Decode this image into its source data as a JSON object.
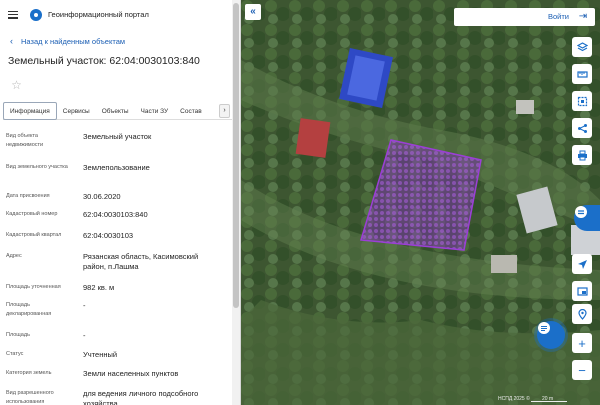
{
  "header": {
    "menu_icon": "hamburger-icon",
    "logo_icon": "portal-logo-icon",
    "title": "Геоинформационный портал"
  },
  "back_link": {
    "label": "Назад к найденным объектам",
    "icon": "chevron-left-icon"
  },
  "object": {
    "title": "Земельный участок: 62:04:0030103:840",
    "favorite_icon": "star-icon"
  },
  "tabs": [
    {
      "label": "Информация",
      "active": true
    },
    {
      "label": "Сервисы",
      "active": false
    },
    {
      "label": "Объекты",
      "active": false
    },
    {
      "label": "Части ЗУ",
      "active": false
    },
    {
      "label": "Состав",
      "active": false
    }
  ],
  "tab_scroll_icon": "chevron-right-icon",
  "attributes": [
    {
      "label": "Вид объекта недвижимости",
      "value": "Земельный участок"
    },
    {
      "label": "Вид земельного участка",
      "value": "Землепользование"
    },
    {
      "label": "Дата присвоения",
      "value": "30.06.2020"
    },
    {
      "label": "Кадастровый номер",
      "value": "62:04:0030103:840"
    },
    {
      "label": "Кадастровый квартал",
      "value": "62:04:0030103"
    },
    {
      "label": "Адрес",
      "value": "Рязанская область, Касимовский район, п.Лашма"
    },
    {
      "label": "Площадь уточненная",
      "value": "982 кв. м"
    },
    {
      "label": "Площадь декларированная",
      "value": "-"
    },
    {
      "label": "Площадь",
      "value": "-"
    },
    {
      "label": "Статус",
      "value": "Учтенный"
    },
    {
      "label": "Категория земель",
      "value": "Земли населенных пунктов"
    },
    {
      "label": "Вид разрешенного использования",
      "value": "для ведения личного подсобного хозяйства"
    }
  ],
  "map": {
    "collapse_icon": "double-chevron-left-icon",
    "login_label": "Войти",
    "login_icon": "login-icon",
    "tools": [
      "layers-icon",
      "ruler-icon",
      "select-area-icon",
      "share-icon",
      "print-icon",
      "location-arrow-icon",
      "map-switch-icon",
      "map-marker-icon",
      "zoom-in-icon",
      "zoom-out-icon"
    ],
    "zoom_in_label": "+",
    "zoom_out_label": "−",
    "attribution": "НСПД 2025 ©",
    "scale_label": "20 m",
    "accent": "#1b6fc9",
    "parcel_color": "#9b3fd6"
  }
}
